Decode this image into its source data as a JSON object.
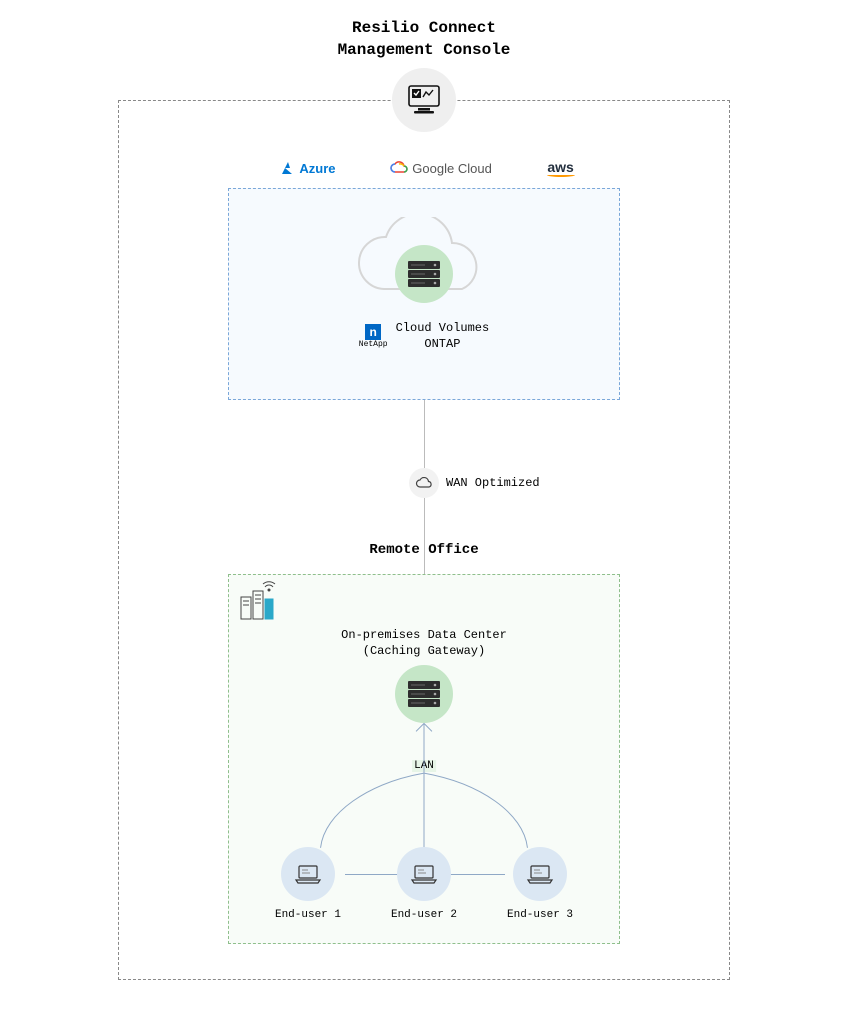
{
  "title_line1": "Resilio Connect",
  "title_line2": "Management Console",
  "clouds": {
    "azure": "Azure",
    "google": "Google Cloud",
    "aws": "aws"
  },
  "ontap": {
    "netapp_label": "NetApp",
    "line1": "Cloud Volumes",
    "line2": "ONTAP"
  },
  "wan_label": "WAN Optimized",
  "remote": {
    "title": "Remote Office",
    "dc_line1": "On-premises Data Center",
    "dc_line2": "(Caching Gateway)",
    "lan_label": "LAN",
    "users": [
      "End-user 1",
      "End-user 2",
      "End-user 3"
    ]
  }
}
